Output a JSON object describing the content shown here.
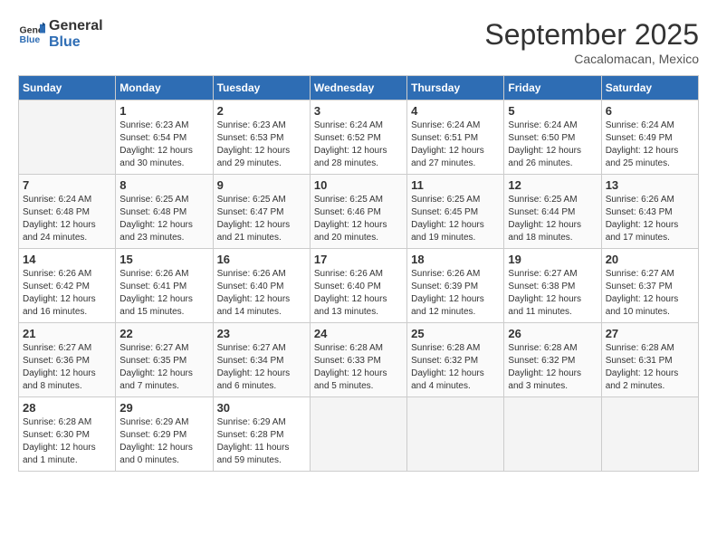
{
  "header": {
    "logo_line1": "General",
    "logo_line2": "Blue",
    "month": "September 2025",
    "location": "Cacalomacan, Mexico"
  },
  "days_of_week": [
    "Sunday",
    "Monday",
    "Tuesday",
    "Wednesday",
    "Thursday",
    "Friday",
    "Saturday"
  ],
  "weeks": [
    [
      {
        "num": "",
        "info": ""
      },
      {
        "num": "1",
        "info": "Sunrise: 6:23 AM\nSunset: 6:54 PM\nDaylight: 12 hours\nand 30 minutes."
      },
      {
        "num": "2",
        "info": "Sunrise: 6:23 AM\nSunset: 6:53 PM\nDaylight: 12 hours\nand 29 minutes."
      },
      {
        "num": "3",
        "info": "Sunrise: 6:24 AM\nSunset: 6:52 PM\nDaylight: 12 hours\nand 28 minutes."
      },
      {
        "num": "4",
        "info": "Sunrise: 6:24 AM\nSunset: 6:51 PM\nDaylight: 12 hours\nand 27 minutes."
      },
      {
        "num": "5",
        "info": "Sunrise: 6:24 AM\nSunset: 6:50 PM\nDaylight: 12 hours\nand 26 minutes."
      },
      {
        "num": "6",
        "info": "Sunrise: 6:24 AM\nSunset: 6:49 PM\nDaylight: 12 hours\nand 25 minutes."
      }
    ],
    [
      {
        "num": "7",
        "info": "Sunrise: 6:24 AM\nSunset: 6:48 PM\nDaylight: 12 hours\nand 24 minutes."
      },
      {
        "num": "8",
        "info": "Sunrise: 6:25 AM\nSunset: 6:48 PM\nDaylight: 12 hours\nand 23 minutes."
      },
      {
        "num": "9",
        "info": "Sunrise: 6:25 AM\nSunset: 6:47 PM\nDaylight: 12 hours\nand 21 minutes."
      },
      {
        "num": "10",
        "info": "Sunrise: 6:25 AM\nSunset: 6:46 PM\nDaylight: 12 hours\nand 20 minutes."
      },
      {
        "num": "11",
        "info": "Sunrise: 6:25 AM\nSunset: 6:45 PM\nDaylight: 12 hours\nand 19 minutes."
      },
      {
        "num": "12",
        "info": "Sunrise: 6:25 AM\nSunset: 6:44 PM\nDaylight: 12 hours\nand 18 minutes."
      },
      {
        "num": "13",
        "info": "Sunrise: 6:26 AM\nSunset: 6:43 PM\nDaylight: 12 hours\nand 17 minutes."
      }
    ],
    [
      {
        "num": "14",
        "info": "Sunrise: 6:26 AM\nSunset: 6:42 PM\nDaylight: 12 hours\nand 16 minutes."
      },
      {
        "num": "15",
        "info": "Sunrise: 6:26 AM\nSunset: 6:41 PM\nDaylight: 12 hours\nand 15 minutes."
      },
      {
        "num": "16",
        "info": "Sunrise: 6:26 AM\nSunset: 6:40 PM\nDaylight: 12 hours\nand 14 minutes."
      },
      {
        "num": "17",
        "info": "Sunrise: 6:26 AM\nSunset: 6:40 PM\nDaylight: 12 hours\nand 13 minutes."
      },
      {
        "num": "18",
        "info": "Sunrise: 6:26 AM\nSunset: 6:39 PM\nDaylight: 12 hours\nand 12 minutes."
      },
      {
        "num": "19",
        "info": "Sunrise: 6:27 AM\nSunset: 6:38 PM\nDaylight: 12 hours\nand 11 minutes."
      },
      {
        "num": "20",
        "info": "Sunrise: 6:27 AM\nSunset: 6:37 PM\nDaylight: 12 hours\nand 10 minutes."
      }
    ],
    [
      {
        "num": "21",
        "info": "Sunrise: 6:27 AM\nSunset: 6:36 PM\nDaylight: 12 hours\nand 8 minutes."
      },
      {
        "num": "22",
        "info": "Sunrise: 6:27 AM\nSunset: 6:35 PM\nDaylight: 12 hours\nand 7 minutes."
      },
      {
        "num": "23",
        "info": "Sunrise: 6:27 AM\nSunset: 6:34 PM\nDaylight: 12 hours\nand 6 minutes."
      },
      {
        "num": "24",
        "info": "Sunrise: 6:28 AM\nSunset: 6:33 PM\nDaylight: 12 hours\nand 5 minutes."
      },
      {
        "num": "25",
        "info": "Sunrise: 6:28 AM\nSunset: 6:32 PM\nDaylight: 12 hours\nand 4 minutes."
      },
      {
        "num": "26",
        "info": "Sunrise: 6:28 AM\nSunset: 6:32 PM\nDaylight: 12 hours\nand 3 minutes."
      },
      {
        "num": "27",
        "info": "Sunrise: 6:28 AM\nSunset: 6:31 PM\nDaylight: 12 hours\nand 2 minutes."
      }
    ],
    [
      {
        "num": "28",
        "info": "Sunrise: 6:28 AM\nSunset: 6:30 PM\nDaylight: 12 hours\nand 1 minute."
      },
      {
        "num": "29",
        "info": "Sunrise: 6:29 AM\nSunset: 6:29 PM\nDaylight: 12 hours\nand 0 minutes."
      },
      {
        "num": "30",
        "info": "Sunrise: 6:29 AM\nSunset: 6:28 PM\nDaylight: 11 hours\nand 59 minutes."
      },
      {
        "num": "",
        "info": ""
      },
      {
        "num": "",
        "info": ""
      },
      {
        "num": "",
        "info": ""
      },
      {
        "num": "",
        "info": ""
      }
    ]
  ]
}
